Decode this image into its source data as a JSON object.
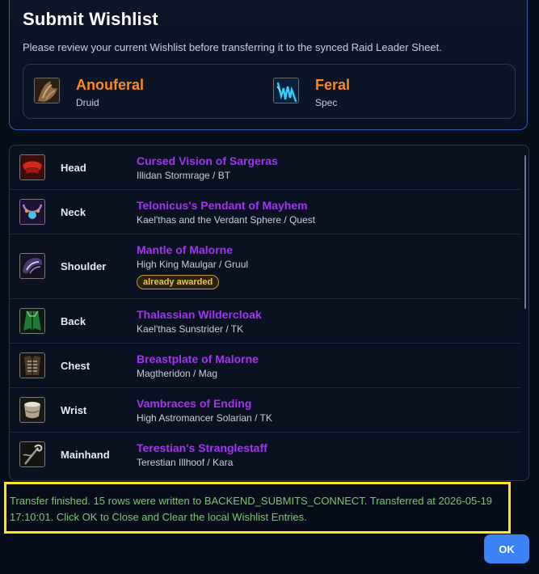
{
  "dialog": {
    "title": "Submit Wishlist",
    "subtitle": "Please review your current Wishlist before transferring it to the synced Raid Leader Sheet."
  },
  "character": {
    "name": "Anouferal",
    "class": "Druid",
    "class_icon": "druid-class-icon",
    "spec_name": "Feral",
    "spec_label": "Spec",
    "spec_icon": "feral-spec-icon"
  },
  "slots": [
    {
      "slot": "Head",
      "item": "Cursed Vision of Sargeras",
      "source": "Illidan Stormrage / BT",
      "icon": "helm-icon"
    },
    {
      "slot": "Neck",
      "item": "Telonicus's Pendant of Mayhem",
      "source": "Kael'thas and the Verdant Sphere / Quest",
      "icon": "necklace-icon"
    },
    {
      "slot": "Shoulder",
      "item": "Mantle of Malorne",
      "source": "High King Maulgar / Gruul",
      "badge": "already awarded",
      "icon": "shoulder-icon"
    },
    {
      "slot": "Back",
      "item": "Thalassian Wildercloak",
      "source": "Kael'thas Sunstrider / TK",
      "icon": "cloak-icon"
    },
    {
      "slot": "Chest",
      "item": "Breastplate of Malorne",
      "source": "Magtheridon / Mag",
      "icon": "chest-icon"
    },
    {
      "slot": "Wrist",
      "item": "Vambraces of Ending",
      "source": "High Astromancer Solarian / TK",
      "icon": "bracer-icon"
    },
    {
      "slot": "Mainhand",
      "item": "Terestian's Stranglestaff",
      "source": "Terestian Illhoof / Kara",
      "icon": "staff-icon"
    }
  ],
  "status": {
    "message": "Transfer finished. 15 rows were written to BACKEND_SUBMITS_CONNECT. Transferred at 2026-05-19 17:10:01. Click OK to Close and Clear the local Wishlist Entries."
  },
  "actions": {
    "ok_label": "OK"
  },
  "colors": {
    "epic": "#a335ee",
    "class_druid": "#ff8a1a",
    "accent": "#3b82f6",
    "status_text": "#7cc576",
    "highlight": "#ffe41f"
  }
}
